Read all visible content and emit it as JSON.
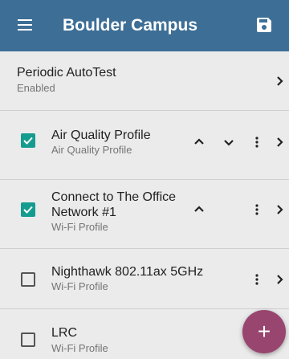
{
  "appbar": {
    "title": "Boulder Campus",
    "menu_icon": "hamburger-menu-icon",
    "save_icon": "save-floppy-icon",
    "bg_color": "#3d6e96"
  },
  "periodic": {
    "title": "Periodic AutoTest",
    "status": "Enabled"
  },
  "profiles": [
    {
      "name": "Air Quality Profile",
      "type": "Air Quality Profile",
      "checked": true
    },
    {
      "name_line1": "Connect to The Office",
      "name_line2": "Network #1",
      "type": "Wi-Fi Profile",
      "checked": true
    },
    {
      "name": "Nighthawk 802.11ax 5GHz",
      "type": "Wi-Fi Profile",
      "checked": false
    },
    {
      "name": "LRC",
      "type": "Wi-Fi Profile",
      "checked": false
    }
  ],
  "fab": {
    "label": "+",
    "icon": "add-icon",
    "color": "#98466f"
  },
  "colors": {
    "checkbox_checked": "#159c8f",
    "background": "#ebebeb"
  }
}
